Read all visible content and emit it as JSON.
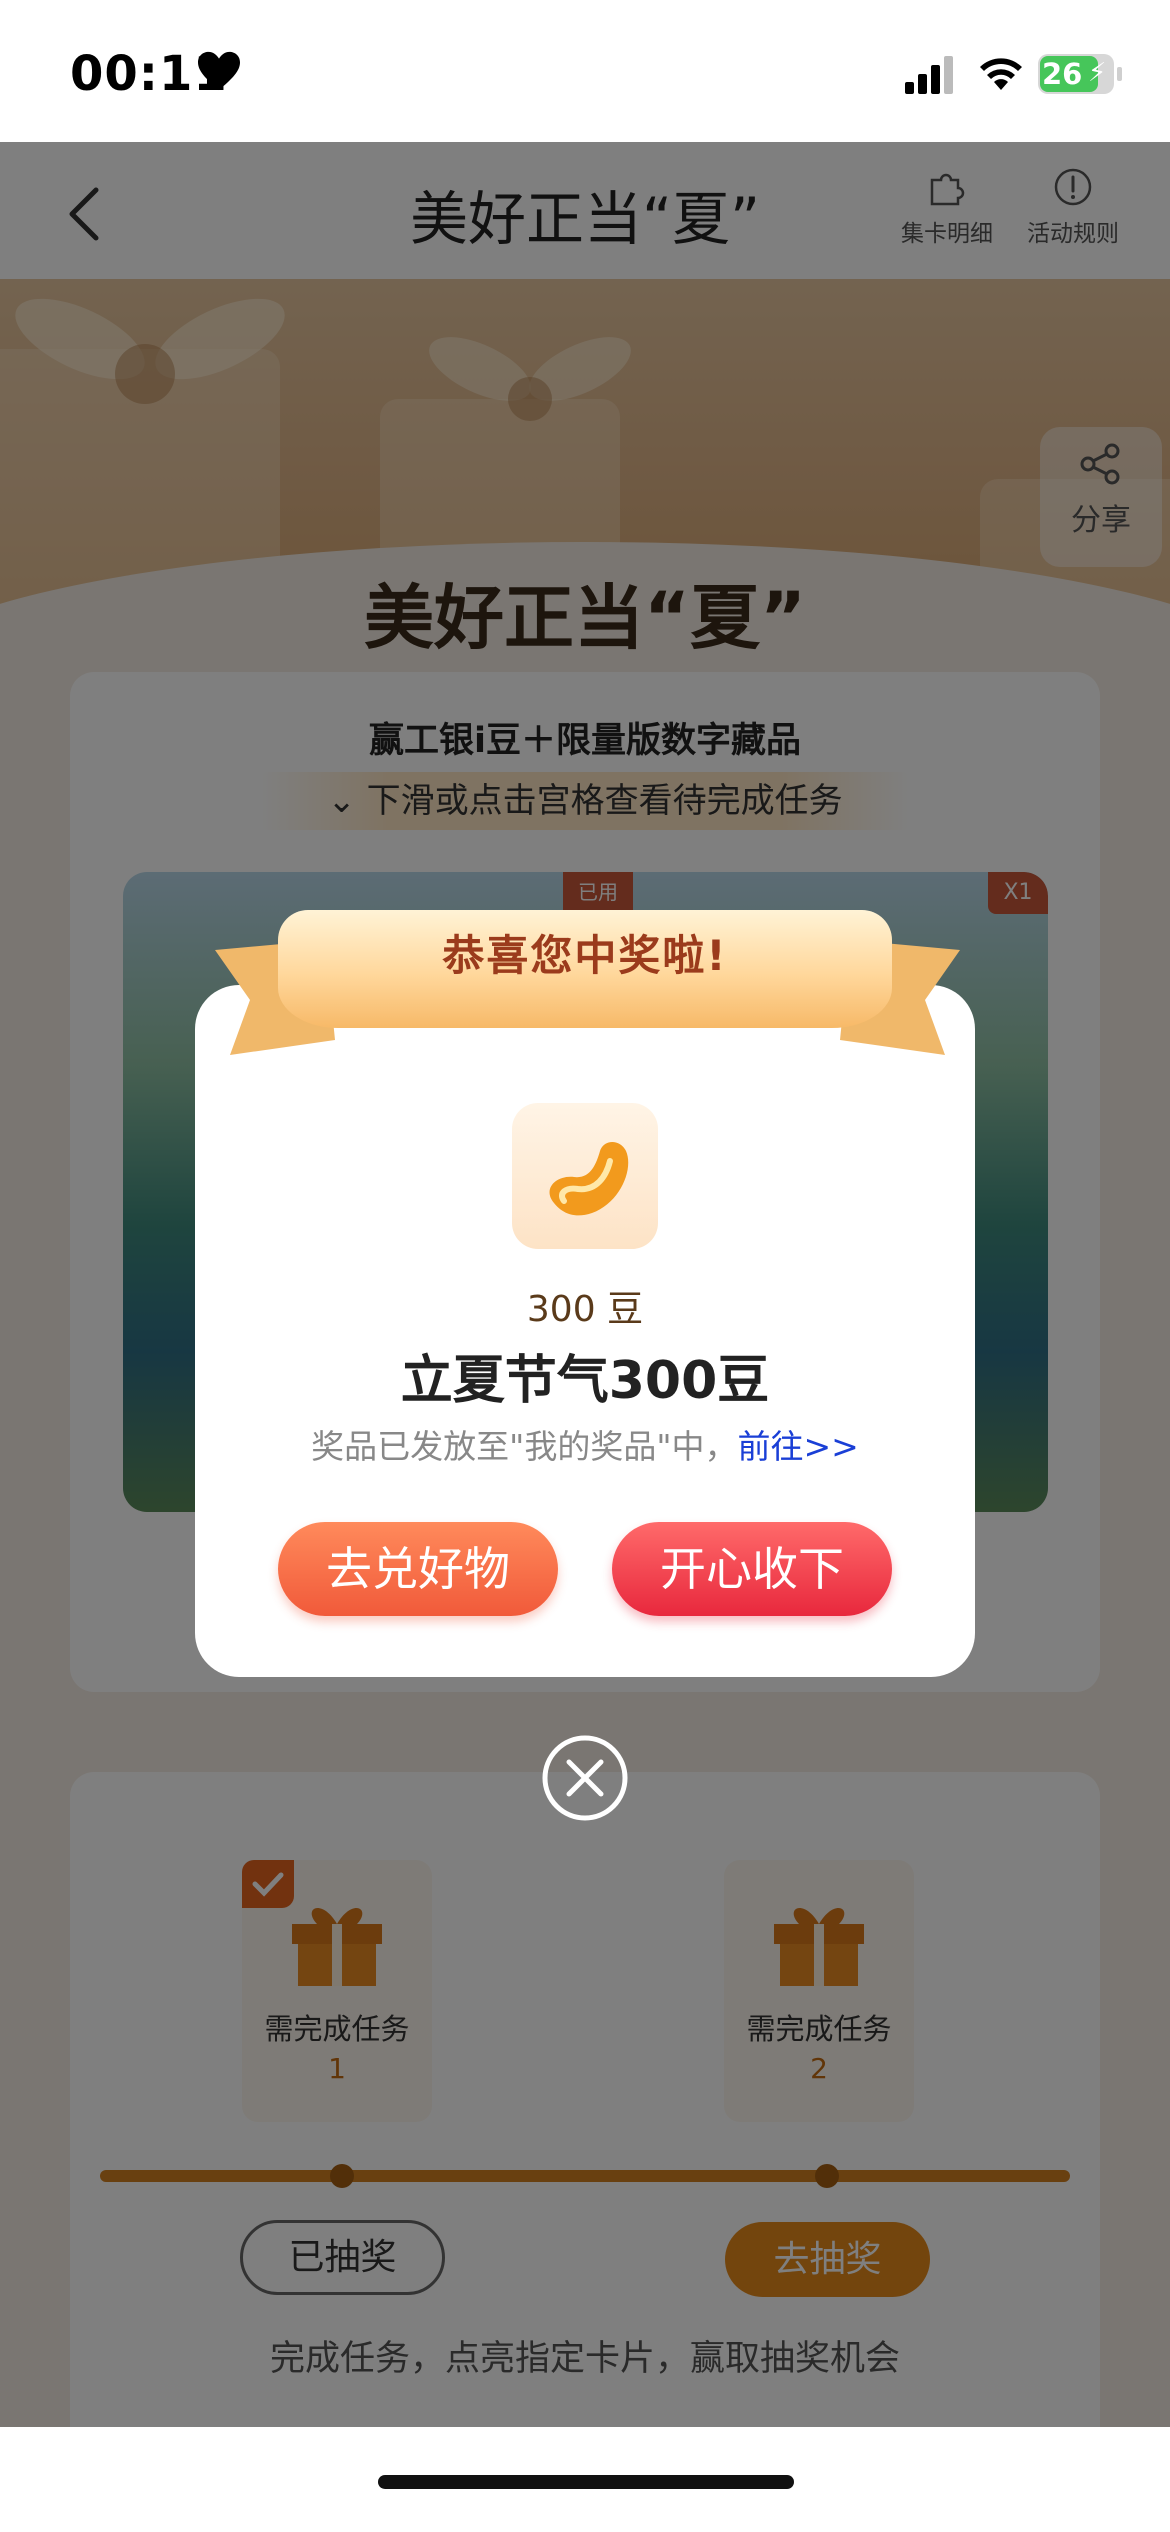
{
  "status_bar": {
    "time": "00:11",
    "battery": "26"
  },
  "nav": {
    "title": "美好正当“夏”",
    "card_detail_label": "集卡明细",
    "rules_label": "活动规则"
  },
  "banner": {
    "share_label": "分享"
  },
  "page": {
    "heading": "美好正当“夏”",
    "subtitle": "赢工银i豆＋限量版数字藏品",
    "hint": "下滑或点击宫格查看待完成任务",
    "photo_tag": "X1",
    "photo_mark": "已用"
  },
  "tasks": {
    "items": [
      {
        "label": "需完成任务",
        "number": "1"
      },
      {
        "label": "需完成任务",
        "number": "2"
      }
    ],
    "drawn_label": "已抽奖",
    "draw_label": "去抽奖",
    "note": "完成任务，点亮指定卡片，赢取抽奖机会"
  },
  "modal": {
    "ribbon_title": "恭喜您中奖啦!",
    "quantity": "300 豆",
    "prize_name": "立夏节气300豆",
    "note_text": "奖品已发放至\"我的奖品\"中，",
    "note_link": "前往>>",
    "exchange_label": "去兑好物",
    "accept_label": "开心收下"
  },
  "colors": {
    "accent_orange": "#f15a3a",
    "accent_red": "#e8283d",
    "ribbon_text": "#9b3b1c",
    "link_blue": "#1a3fd6"
  }
}
